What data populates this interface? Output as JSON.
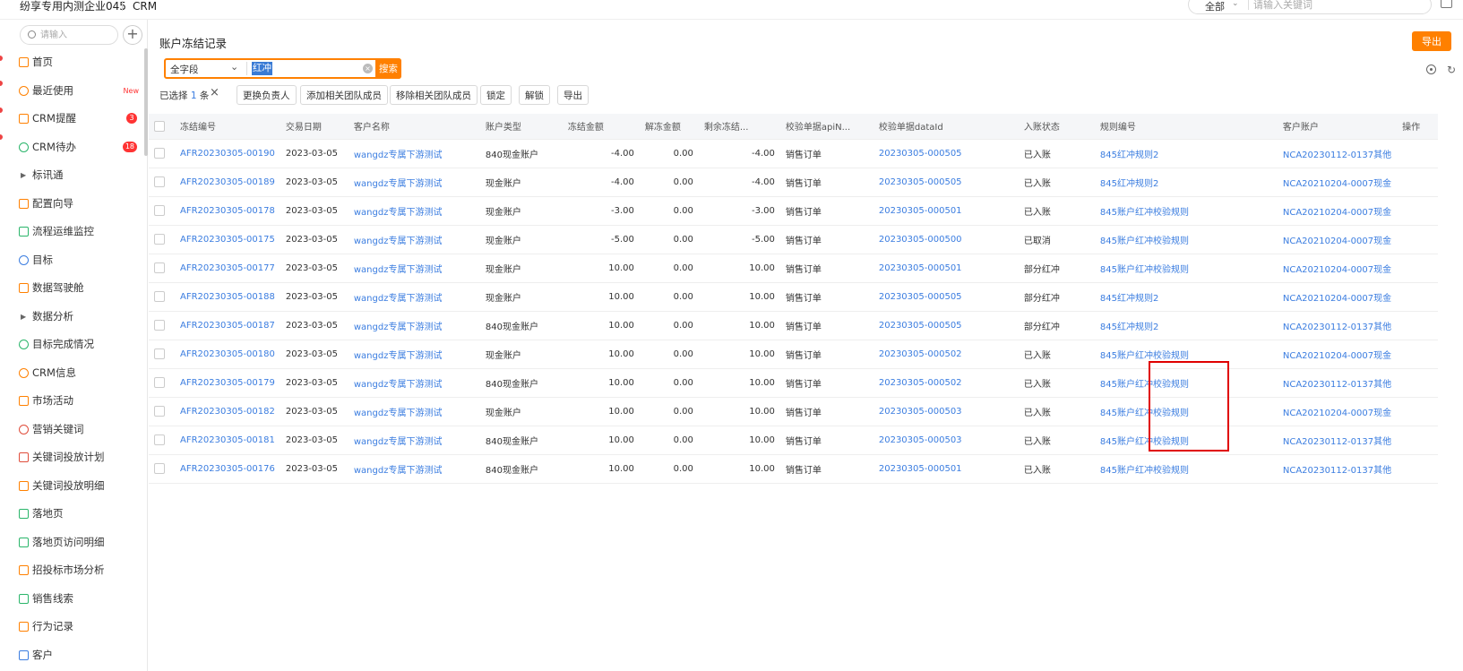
{
  "header": {
    "company": "纷享专用内测企业045",
    "app": "CRM",
    "search_scope": "全部",
    "search_placeholder": "请输入关键词"
  },
  "sidebar": {
    "search_placeholder": "请输入",
    "add_label": "+",
    "items": [
      {
        "label": "首页"
      },
      {
        "label": "最近使用",
        "tag": "New"
      },
      {
        "label": "CRM提醒",
        "badge": "3"
      },
      {
        "label": "CRM待办",
        "badge": "18"
      },
      {
        "label": "标讯通"
      },
      {
        "label": "配置向导"
      },
      {
        "label": "流程运维监控"
      },
      {
        "label": "目标"
      },
      {
        "label": "数据驾驶舱"
      },
      {
        "label": "数据分析"
      },
      {
        "label": "目标完成情况"
      },
      {
        "label": "CRM信息"
      },
      {
        "label": "市场活动"
      },
      {
        "label": "营销关键词"
      },
      {
        "label": "关键词投放计划"
      },
      {
        "label": "关键词投放明细"
      },
      {
        "label": "落地页"
      },
      {
        "label": "落地页访问明细"
      },
      {
        "label": "招投标市场分析"
      },
      {
        "label": "销售线索"
      },
      {
        "label": "行为记录"
      },
      {
        "label": "客户"
      }
    ]
  },
  "main": {
    "title": "账户冻结记录",
    "export_label": "导出",
    "filter": {
      "field": "全字段",
      "keyword": "红冲",
      "search_label": "搜索"
    },
    "selection": {
      "prefix": "已选择",
      "count": "1",
      "suffix": "条"
    },
    "actions": [
      "更换负责人",
      "添加相关团队成员",
      "移除相关团队成员",
      "锁定",
      "解锁",
      "导出"
    ],
    "table": {
      "columns": [
        "冻结编号",
        "交易日期",
        "客户名称",
        "账户类型",
        "冻结金额",
        "解冻金额",
        "剩余冻结...",
        "校验单据apiN...",
        "校验单据dataId",
        "入账状态",
        "规则编号",
        "客户账户",
        "操作"
      ],
      "rows": [
        [
          "AFR20230305-00190",
          "2023-03-05",
          "wangdz专属下游测试",
          "840现金账户",
          "-4.00",
          "0.00",
          "-4.00",
          "销售订单",
          "20230305-000505",
          "已入账",
          "845红冲规则2",
          "NCA20230112-0137其他"
        ],
        [
          "AFR20230305-00189",
          "2023-03-05",
          "wangdz专属下游测试",
          "现金账户",
          "-4.00",
          "0.00",
          "-4.00",
          "销售订单",
          "20230305-000505",
          "已入账",
          "845红冲规则2",
          "NCA20210204-0007现金"
        ],
        [
          "AFR20230305-00178",
          "2023-03-05",
          "wangdz专属下游测试",
          "现金账户",
          "-3.00",
          "0.00",
          "-3.00",
          "销售订单",
          "20230305-000501",
          "已入账",
          "845账户红冲校验规则",
          "NCA20210204-0007现金"
        ],
        [
          "AFR20230305-00175",
          "2023-03-05",
          "wangdz专属下游测试",
          "现金账户",
          "-5.00",
          "0.00",
          "-5.00",
          "销售订单",
          "20230305-000500",
          "已取消",
          "845账户红冲校验规则",
          "NCA20210204-0007现金"
        ],
        [
          "AFR20230305-00177",
          "2023-03-05",
          "wangdz专属下游测试",
          "现金账户",
          "10.00",
          "0.00",
          "10.00",
          "销售订单",
          "20230305-000501",
          "部分红冲",
          "845账户红冲校验规则",
          "NCA20210204-0007现金"
        ],
        [
          "AFR20230305-00188",
          "2023-03-05",
          "wangdz专属下游测试",
          "现金账户",
          "10.00",
          "0.00",
          "10.00",
          "销售订单",
          "20230305-000505",
          "部分红冲",
          "845红冲规则2",
          "NCA20210204-0007现金"
        ],
        [
          "AFR20230305-00187",
          "2023-03-05",
          "wangdz专属下游测试",
          "840现金账户",
          "10.00",
          "0.00",
          "10.00",
          "销售订单",
          "20230305-000505",
          "部分红冲",
          "845红冲规则2",
          "NCA20230112-0137其他"
        ],
        [
          "AFR20230305-00180",
          "2023-03-05",
          "wangdz专属下游测试",
          "现金账户",
          "10.00",
          "0.00",
          "10.00",
          "销售订单",
          "20230305-000502",
          "已入账",
          "845账户红冲校验规则",
          "NCA20210204-0007现金"
        ],
        [
          "AFR20230305-00179",
          "2023-03-05",
          "wangdz专属下游测试",
          "840现金账户",
          "10.00",
          "0.00",
          "10.00",
          "销售订单",
          "20230305-000502",
          "已入账",
          "845账户红冲校验规则",
          "NCA20230112-0137其他"
        ],
        [
          "AFR20230305-00182",
          "2023-03-05",
          "wangdz专属下游测试",
          "现金账户",
          "10.00",
          "0.00",
          "10.00",
          "销售订单",
          "20230305-000503",
          "已入账",
          "845账户红冲校验规则",
          "NCA20210204-0007现金"
        ],
        [
          "AFR20230305-00181",
          "2023-03-05",
          "wangdz专属下游测试",
          "840现金账户",
          "10.00",
          "0.00",
          "10.00",
          "销售订单",
          "20230305-000503",
          "已入账",
          "845账户红冲校验规则",
          "NCA20230112-0137其他"
        ],
        [
          "AFR20230305-00176",
          "2023-03-05",
          "wangdz专属下游测试",
          "840现金账户",
          "10.00",
          "0.00",
          "10.00",
          "销售订单",
          "20230305-000501",
          "已入账",
          "845账户红冲校验规则",
          "NCA20230112-0137其他"
        ]
      ]
    }
  },
  "colors": {
    "accent": "#ff8000",
    "link": "#3b7de0",
    "annotation_box": "#e00000"
  }
}
